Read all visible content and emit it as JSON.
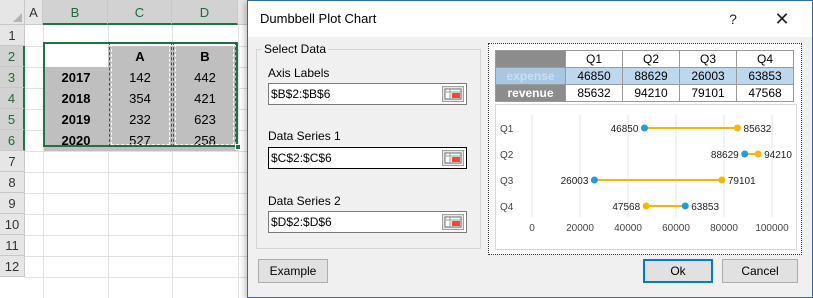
{
  "spreadsheet": {
    "columns": [
      "A",
      "B",
      "C",
      "D"
    ],
    "rows": [
      "1",
      "2",
      "3",
      "4",
      "5",
      "6",
      "7",
      "8",
      "9",
      "10",
      "11",
      "12"
    ],
    "table": {
      "header": [
        "",
        "A",
        "B"
      ],
      "body": [
        [
          "2017",
          "142",
          "442"
        ],
        [
          "2018",
          "354",
          "421"
        ],
        [
          "2019",
          "232",
          "623"
        ],
        [
          "2020",
          "527",
          "258"
        ]
      ]
    }
  },
  "dialog": {
    "title": "Dumbbell Plot Chart",
    "help_label": "?",
    "close_label": "✕",
    "group_label": "Select Data",
    "axis_labels": {
      "label": "Axis Labels",
      "value": "$B$2:$B$6"
    },
    "series1": {
      "label": "Data Series 1",
      "value": "$C$2:$C$6"
    },
    "series2": {
      "label": "Data Series 2",
      "value": "$D$2:$D$6"
    },
    "example_label": "Example",
    "ok_label": "Ok",
    "cancel_label": "Cancel"
  },
  "preview_table": {
    "quarters": [
      "Q1",
      "Q2",
      "Q3",
      "Q4"
    ],
    "rows": [
      {
        "label": "expense",
        "values": [
          "46850",
          "88629",
          "26003",
          "63853"
        ]
      },
      {
        "label": "revenue",
        "values": [
          "85632",
          "94210",
          "79101",
          "47568"
        ]
      }
    ]
  },
  "chart_data": {
    "type": "scatter",
    "subtype": "dumbbell",
    "categories": [
      "Q1",
      "Q2",
      "Q3",
      "Q4"
    ],
    "series": [
      {
        "values": [
          46850,
          88629,
          26003,
          63853
        ],
        "color": "#1f9bde"
      },
      {
        "values": [
          85632,
          94210,
          79101,
          47568
        ],
        "color": "#f5b800"
      }
    ],
    "xticks": [
      "0",
      "20000",
      "40000",
      "60000",
      "80000",
      "100000"
    ],
    "xlim": [
      0,
      100000
    ],
    "grid": true,
    "connector_color": "#f5b800"
  },
  "colors": {
    "accent": "#217346",
    "dialog_border": "#2b6cb0",
    "table_header_gray": "#8c8c8c",
    "expense_row": "#bdd7ee"
  },
  "icons": {
    "range_picker": "range-select-icon",
    "close": "close-icon",
    "help": "help-icon"
  }
}
